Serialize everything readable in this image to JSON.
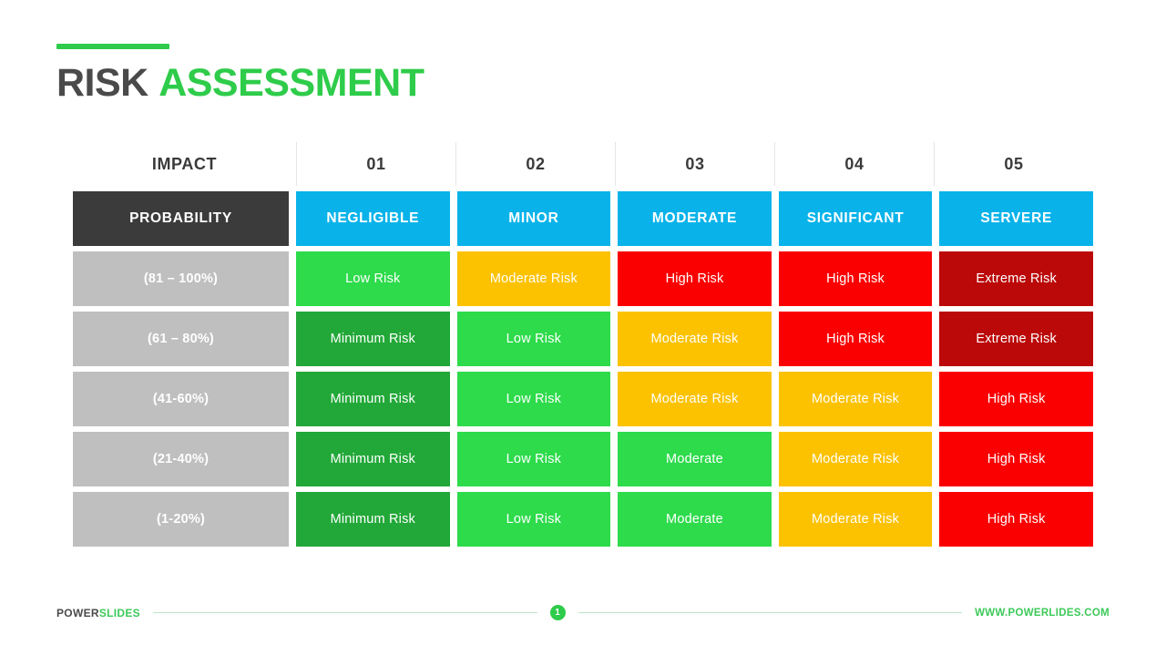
{
  "title": {
    "part1": "RISK",
    "part2": "ASSESSMENT"
  },
  "colors": {
    "accent_green": "#2ecc4a",
    "title_dark": "#4a4a4a",
    "header_blue": "#09b3ea",
    "probability_dark": "#3b3b3b",
    "row_label_gray": "#bfbfbf",
    "minimum_risk": "#22a838",
    "low_risk": "#2ddb4b",
    "moderate_risk": "#fcc200",
    "high_risk": "#fa0000",
    "extreme_risk": "#bb0808"
  },
  "matrix": {
    "impact_label": "IMPACT",
    "impact_numbers": [
      "01",
      "02",
      "03",
      "04",
      "05"
    ],
    "probability_label": "PROBABILITY",
    "impact_levels": [
      "NEGLIGIBLE",
      "MINOR",
      "MODERATE",
      "SIGNIFICANT",
      "SERVERE"
    ],
    "rows": [
      {
        "label": "(81 – 100%)",
        "cells": [
          {
            "text": "Low Risk",
            "level": "low"
          },
          {
            "text": "Moderate Risk",
            "level": "moderate"
          },
          {
            "text": "High Risk",
            "level": "high"
          },
          {
            "text": "High Risk",
            "level": "high"
          },
          {
            "text": "Extreme Risk",
            "level": "extreme"
          }
        ]
      },
      {
        "label": "(61 – 80%)",
        "cells": [
          {
            "text": "Minimum Risk",
            "level": "minimum"
          },
          {
            "text": "Low Risk",
            "level": "low"
          },
          {
            "text": "Moderate Risk",
            "level": "moderate"
          },
          {
            "text": "High Risk",
            "level": "high"
          },
          {
            "text": "Extreme Risk",
            "level": "extreme"
          }
        ]
      },
      {
        "label": "(41-60%)",
        "cells": [
          {
            "text": "Minimum Risk",
            "level": "minimum"
          },
          {
            "text": "Low Risk",
            "level": "low"
          },
          {
            "text": "Moderate Risk",
            "level": "moderate"
          },
          {
            "text": "Moderate Risk",
            "level": "moderate"
          },
          {
            "text": "High Risk",
            "level": "high"
          }
        ]
      },
      {
        "label": "(21-40%)",
        "cells": [
          {
            "text": "Minimum Risk",
            "level": "minimum"
          },
          {
            "text": "Low Risk",
            "level": "low"
          },
          {
            "text": "Moderate",
            "level": "low"
          },
          {
            "text": "Moderate Risk",
            "level": "moderate"
          },
          {
            "text": "High Risk",
            "level": "high"
          }
        ]
      },
      {
        "label": "(1-20%)",
        "cells": [
          {
            "text": "Minimum Risk",
            "level": "minimum"
          },
          {
            "text": "Low Risk",
            "level": "low"
          },
          {
            "text": "Moderate",
            "level": "low"
          },
          {
            "text": "Moderate Risk",
            "level": "moderate"
          },
          {
            "text": "High Risk",
            "level": "high"
          }
        ]
      }
    ]
  },
  "footer": {
    "brand_part1": "POWER",
    "brand_part2": "SLIDES",
    "page_number": "1",
    "url": "WWW.POWERLIDES.COM"
  }
}
